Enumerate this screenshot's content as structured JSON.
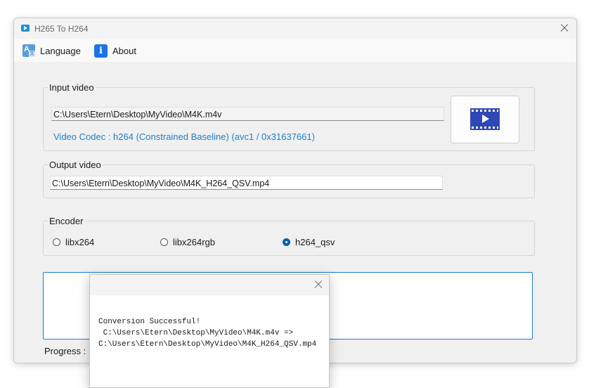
{
  "window": {
    "title": "H265 To H264",
    "app_icon": "video-play-icon"
  },
  "menu": {
    "language_label": "Language",
    "about_label": "About",
    "language_icon": "translate-icon",
    "about_icon": "info-icon"
  },
  "input_video": {
    "group_label": "Input video",
    "path": "C:\\Users\\Etern\\Desktop\\MyVideo\\M4K.m4v",
    "codec_text": "Video Codec : h264 (Constrained Baseline) (avc1 / 0x31637661)",
    "codec_color": "#1e7fc8",
    "browse_icon": "film-play-icon"
  },
  "output_video": {
    "group_label": "Output video",
    "path": "C:\\Users\\Etern\\Desktop\\MyVideo\\M4K_H264_QSV.mp4"
  },
  "encoder": {
    "group_label": "Encoder",
    "options": [
      {
        "label": "libx264",
        "checked": false
      },
      {
        "label": "libx264rgb",
        "checked": false
      },
      {
        "label": "h264_qsv",
        "checked": true
      }
    ]
  },
  "progress": {
    "label": "Progress : "
  },
  "dialog": {
    "message": "Conversion Successful!\n C:\\Users\\Etern\\Desktop\\MyVideo\\M4K.m4v =>\nC:\\Users\\Etern\\Desktop\\MyVideo\\M4K_H264_QSV.mp4"
  },
  "colors": {
    "accent": "#005fb8",
    "focus_border": "#1c7bd0"
  }
}
